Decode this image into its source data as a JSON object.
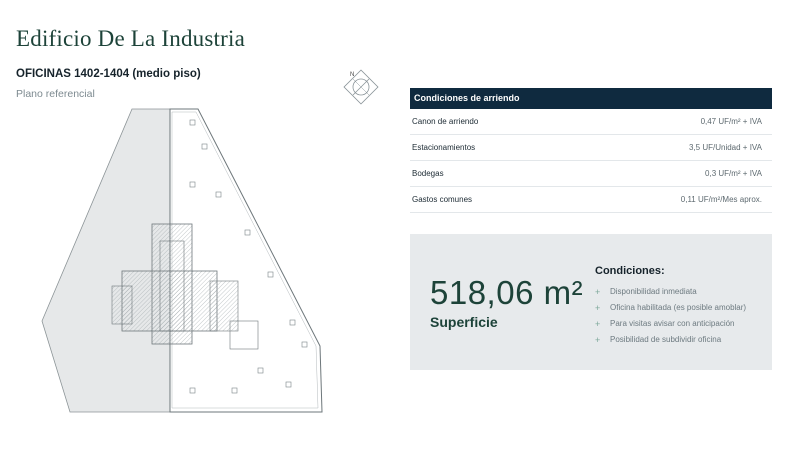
{
  "header": {
    "title": "Edificio De La Industria",
    "subtitle": "OFICINAS 1402-1404 (medio piso)",
    "caption": "Plano referencial"
  },
  "compass": {
    "icon": "north-compass-icon",
    "label": "N"
  },
  "floor_plan": {
    "icon": "floor-plan-drawing"
  },
  "conditions_table": {
    "header": "Condiciones de arriendo",
    "rows": [
      {
        "label": "Canon de arriendo",
        "value": "0,47 UF/m² + IVA"
      },
      {
        "label": "Estacionamientos",
        "value": "3,5 UF/Unidad + IVA"
      },
      {
        "label": "Bodegas",
        "value": "0,3 UF/m² + IVA"
      },
      {
        "label": "Gastos comunes",
        "value": "0,11 UF/m²/Mes aprox."
      }
    ]
  },
  "summary": {
    "area": "518,06 m²",
    "area_label": "Superficie",
    "conditions_title": "Condiciones:",
    "conditions": [
      "Disponibilidad inmediata",
      "Oficina habilitada (es posible amoblar)",
      "Para visitas avisar con anticipación",
      "Posibilidad de subdividir oficina"
    ]
  },
  "colors": {
    "accent": "#1d4339",
    "table_header": "#0f2a3f",
    "box_bg": "#e7eaec",
    "bullet": "#7da89a"
  }
}
